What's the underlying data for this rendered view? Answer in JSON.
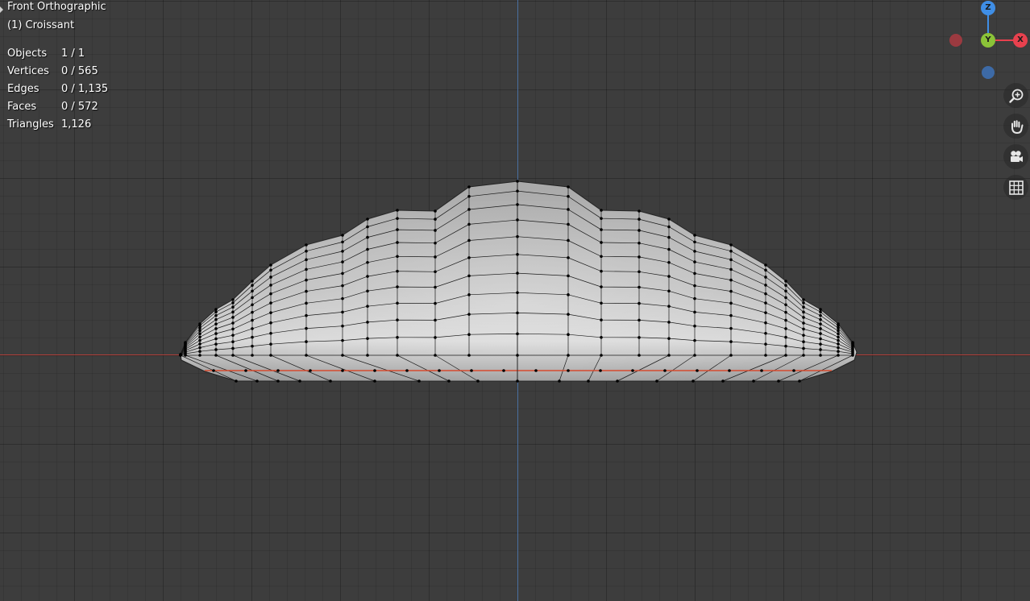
{
  "viewport": {
    "view_name": "Front Orthographic",
    "object_label": "(1) Croissant"
  },
  "stats": [
    {
      "label": "Objects",
      "value": "1 / 1"
    },
    {
      "label": "Vertices",
      "value": "0 / 565"
    },
    {
      "label": "Edges",
      "value": "0 / 1,135"
    },
    {
      "label": "Faces",
      "value": "0 / 572"
    },
    {
      "label": "Triangles",
      "value": "1,126"
    }
  ],
  "gizmo": {
    "z_label": "Z",
    "y_label": "Y",
    "x_label": "X"
  },
  "nav_tools": [
    {
      "name": "zoom-icon"
    },
    {
      "name": "hand-pan-icon"
    },
    {
      "name": "camera-view-icon"
    },
    {
      "name": "grid-perspective-icon"
    }
  ],
  "colors": {
    "background": "#3d3d3d",
    "x_axis": "#e8414e",
    "y_axis": "#8bc338",
    "z_axis": "#3f8ee6",
    "mesh_fill": "#c8c8c8",
    "wire": "#1a1a1a"
  }
}
